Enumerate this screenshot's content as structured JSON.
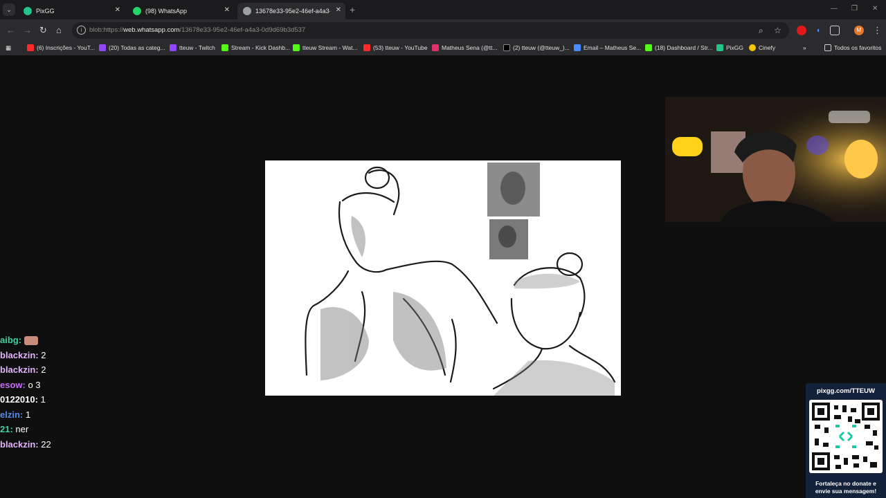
{
  "tabs": [
    {
      "title": "PixGG",
      "color": "#22c48a"
    },
    {
      "title": "(98) WhatsApp",
      "color": "#25d366"
    },
    {
      "title": "13678e33-95e2-46ef-a4a3-0d9",
      "color": "#9aa0a6"
    }
  ],
  "address": {
    "prefix": "blob:https://",
    "domain": "web.whatsapp.com",
    "path": "/13678e33-95e2-46ef-a4a3-0d9d69b3d537"
  },
  "profile_initial": "M",
  "bookmarks": [
    {
      "label": "(6) Inscrições - YouT...",
      "color": "#ff2a2a"
    },
    {
      "label": "(20) Todas as categ...",
      "color": "#9146ff"
    },
    {
      "label": "tteuw - Twitch",
      "color": "#9146ff"
    },
    {
      "label": "Stream - Kick Dashb...",
      "color": "#53fc18"
    },
    {
      "label": "tteuw Stream - Wat...",
      "color": "#53fc18"
    },
    {
      "label": "(53) tteuw - YouTube",
      "color": "#ff2a2a"
    },
    {
      "label": "Matheus Sena (@tt...",
      "color": "#e1306c"
    },
    {
      "label": "(2) tteuw (@tteuw_)...",
      "color": "#ffffff"
    },
    {
      "label": "Email – Matheus Se...",
      "color": "#4a8cff"
    },
    {
      "label": "(18) Dashboard / Str...",
      "color": "#53fc18"
    },
    {
      "label": "PixGG",
      "color": "#22c48a"
    },
    {
      "label": "Cinefy",
      "color": "#f5c400"
    }
  ],
  "all_bookmarks": "Todos os favoritos",
  "chat": [
    {
      "user": "aibg:",
      "msg": "",
      "color": "#3fd1a3",
      "emote": true
    },
    {
      "user": "blackzin:",
      "msg": "2",
      "color": "#e3b3ff"
    },
    {
      "user": "blackzin:",
      "msg": "2",
      "color": "#e3b3ff"
    },
    {
      "user": "esow:",
      "msg": "o 3",
      "color": "#c76cf5"
    },
    {
      "user": "0122010:",
      "msg": "1",
      "color": "#ffffff"
    },
    {
      "user": "elzin:",
      "msg": "1",
      "color": "#4f8de8"
    },
    {
      "user": "21:",
      "msg": "ner",
      "color": "#3fd1a3"
    },
    {
      "user": "blackzin:",
      "msg": "22",
      "color": "#e3b3ff"
    }
  ],
  "pix": {
    "title": "pixgg.com/TTEUW",
    "cta_line1": "Fortaleça no donate e",
    "cta_line2": "envie sua mensagem!"
  }
}
